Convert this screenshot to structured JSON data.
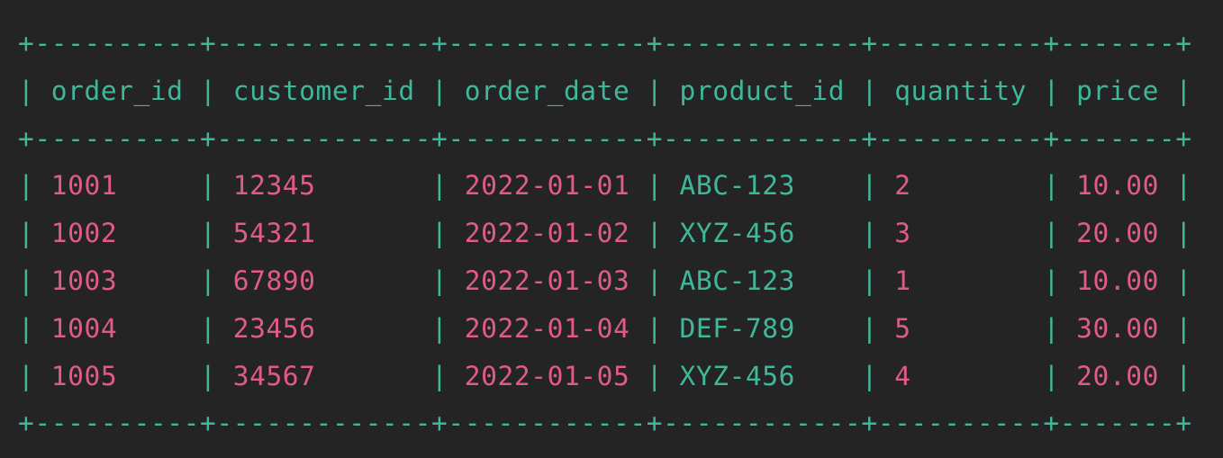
{
  "colors": {
    "background": "#242424",
    "border": "#3fb89a",
    "header_text": "#3fb89a",
    "number_text": "#e05a8a",
    "string_text": "#3fb89a"
  },
  "border_line": "+----------+-------------+------------+------------+----------+-------+",
  "columns": [
    {
      "name": "order_id",
      "width": 10,
      "type": "number"
    },
    {
      "name": "customer_id",
      "width": 13,
      "type": "number"
    },
    {
      "name": "order_date",
      "width": 12,
      "type": "number"
    },
    {
      "name": "product_id",
      "width": 12,
      "type": "string"
    },
    {
      "name": "quantity",
      "width": 10,
      "type": "number"
    },
    {
      "name": "price",
      "width": 7,
      "type": "number"
    }
  ],
  "rows": [
    [
      "1001",
      "12345",
      "2022-01-01",
      "ABC-123",
      "2",
      "10.00"
    ],
    [
      "1002",
      "54321",
      "2022-01-02",
      "XYZ-456",
      "3",
      "20.00"
    ],
    [
      "1003",
      "67890",
      "2022-01-03",
      "ABC-123",
      "1",
      "10.00"
    ],
    [
      "1004",
      "23456",
      "2022-01-04",
      "DEF-789",
      "5",
      "30.00"
    ],
    [
      "1005",
      "34567",
      "2022-01-05",
      "XYZ-456",
      "4",
      "20.00"
    ]
  ]
}
